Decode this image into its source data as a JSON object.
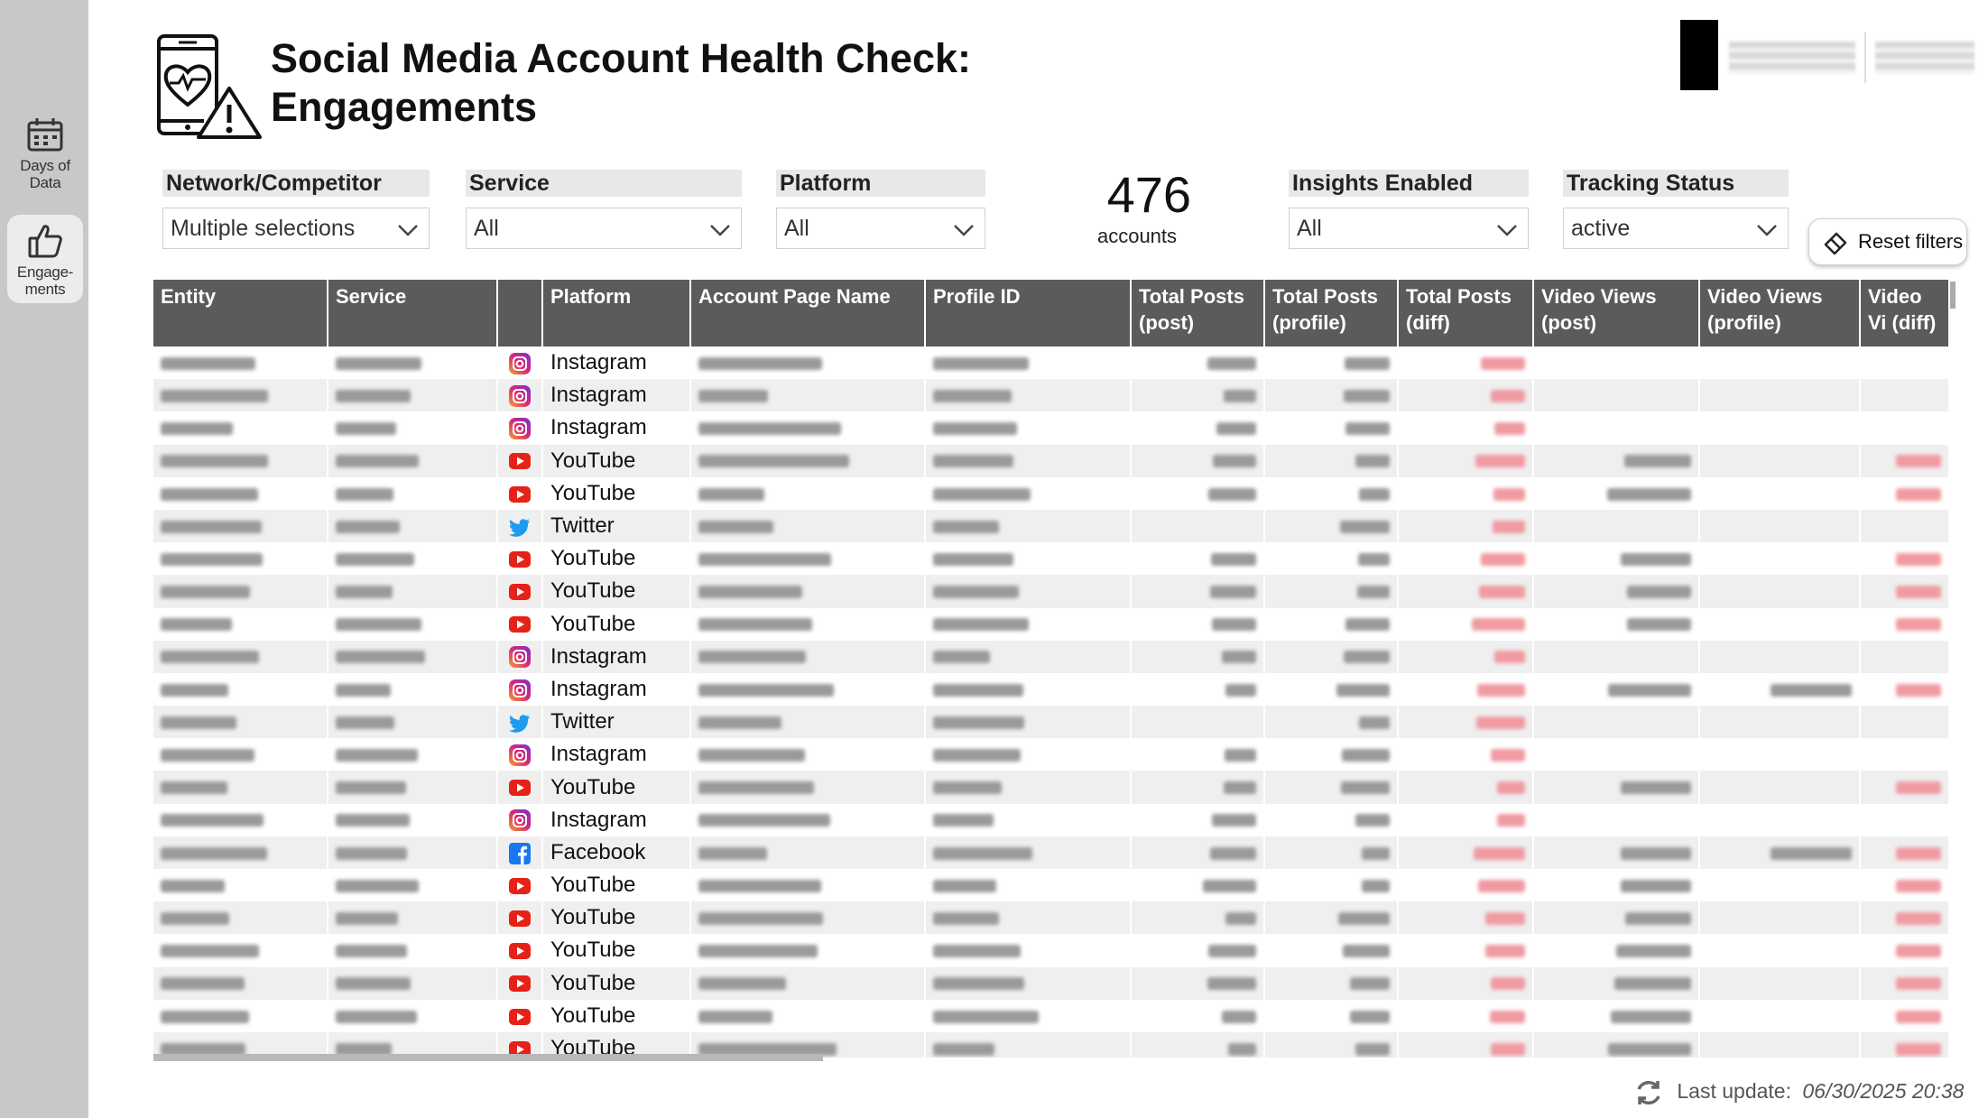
{
  "sidebar": {
    "items": [
      {
        "label": "Days of Data",
        "icon": "calendar-icon",
        "active": false
      },
      {
        "label": "Engage- ments",
        "icon": "thumbs-up-icon",
        "active": true
      }
    ]
  },
  "header": {
    "title_line1": "Social Media Account Health Check:",
    "title_line2": "Engagements"
  },
  "filters": {
    "network": {
      "label": "Network/Competitor",
      "value": "Multiple selections"
    },
    "service": {
      "label": "Service",
      "value": "All"
    },
    "platform": {
      "label": "Platform",
      "value": "All"
    },
    "insights": {
      "label": "Insights Enabled",
      "value": "All"
    },
    "tracking": {
      "label": "Tracking Status",
      "value": "active"
    }
  },
  "counter": {
    "value": "476",
    "label": "accounts"
  },
  "reset_button": {
    "label": "Reset filters"
  },
  "table": {
    "columns": [
      "Entity",
      "Service",
      "",
      "Platform",
      "Account Page Name",
      "Profile ID",
      "Total Posts (post)",
      "Total Posts (profile)",
      "Total Posts (diff)",
      "Video Views (post)",
      "Video Views (profile)",
      "Video Vi (diff)"
    ],
    "rows": [
      {
        "platform": "Instagram"
      },
      {
        "platform": "Instagram"
      },
      {
        "platform": "Instagram"
      },
      {
        "platform": "YouTube"
      },
      {
        "platform": "YouTube"
      },
      {
        "platform": "Twitter"
      },
      {
        "platform": "YouTube"
      },
      {
        "platform": "YouTube"
      },
      {
        "platform": "YouTube"
      },
      {
        "platform": "Instagram"
      },
      {
        "platform": "Instagram"
      },
      {
        "platform": "Twitter"
      },
      {
        "platform": "Instagram"
      },
      {
        "platform": "YouTube"
      },
      {
        "platform": "Instagram"
      },
      {
        "platform": "Facebook"
      },
      {
        "platform": "YouTube"
      },
      {
        "platform": "YouTube"
      },
      {
        "platform": "YouTube"
      },
      {
        "platform": "YouTube"
      },
      {
        "platform": "YouTube"
      },
      {
        "platform": "YouTube"
      }
    ]
  },
  "footer": {
    "label": "Last update:",
    "date": "06/30/2025 20:38"
  },
  "colors": {
    "header_bg": "#5b5b5b",
    "sidebar_bg": "#c8c8c8",
    "negative": "#f09aa2",
    "youtube": "#e62117",
    "twitter": "#1d9bf0",
    "facebook": "#1877f2",
    "instagram": "#d62976"
  }
}
